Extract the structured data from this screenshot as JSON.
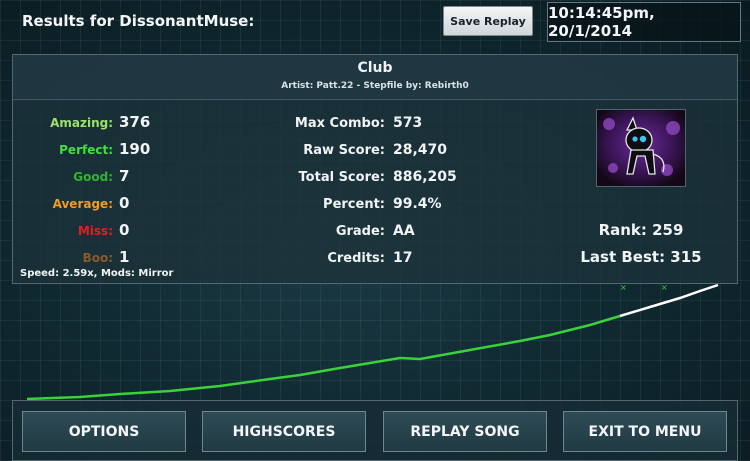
{
  "header": {
    "results_title": "Results for DissonantMuse:",
    "save_replay_label": "Save Replay",
    "clock": "10:14:45pm, 20/1/2014"
  },
  "song": {
    "title": "Club",
    "meta": "Artist: Patt.22  -  Stepfile by: Rebirth0"
  },
  "judgements": [
    {
      "label": "Amazing:",
      "value": "376",
      "color": "#9be26a"
    },
    {
      "label": "Perfect:",
      "value": "190",
      "color": "#40e040"
    },
    {
      "label": "Good:",
      "value": "7",
      "color": "#2fb52f"
    },
    {
      "label": "Average:",
      "value": "0",
      "color": "#f29a2a"
    },
    {
      "label": "Miss:",
      "value": "0",
      "color": "#e02020"
    },
    {
      "label": "Boo:",
      "value": "1",
      "color": "#8a5a2a"
    }
  ],
  "stats": [
    {
      "label": "Max Combo:",
      "value": "573"
    },
    {
      "label": "Raw Score:",
      "value": "28,470"
    },
    {
      "label": "Total Score:",
      "value": "886,205"
    },
    {
      "label": "Percent:",
      "value": "99.4%"
    },
    {
      "label": "Grade:",
      "value": "AA"
    },
    {
      "label": "Credits:",
      "value": "17"
    }
  ],
  "speed_mods": "Speed: 2.59x, Mods: Mirror",
  "rank": {
    "rank_text": "Rank: 259",
    "last_best_text": "Last Best: 315"
  },
  "buttons": {
    "options": "OPTIONS",
    "highscores": "HIGHSCORES",
    "replay_song": "REPLAY SONG",
    "exit_to_menu": "EXIT TO MENU"
  },
  "colors": {
    "graph_green": "#3ad23a",
    "graph_white": "#ffffff",
    "accent_panel": "#1c323a"
  },
  "icons": {
    "avatar": "pony-avatar-icon"
  }
}
